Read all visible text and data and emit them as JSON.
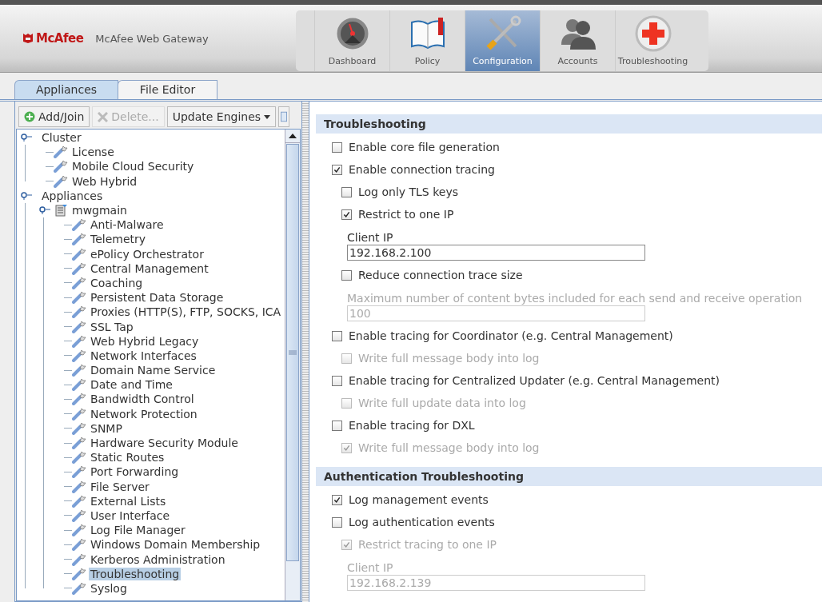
{
  "header": {
    "logo": "McAfee",
    "product": "McAfee Web Gateway"
  },
  "nav": [
    {
      "label": "Dashboard",
      "selected": false
    },
    {
      "label": "Policy",
      "selected": false
    },
    {
      "label": "Configuration",
      "selected": true
    },
    {
      "label": "Accounts",
      "selected": false
    },
    {
      "label": "Troubleshooting",
      "selected": false
    }
  ],
  "tabs": [
    {
      "label": "Appliances",
      "selected": true
    },
    {
      "label": "File Editor",
      "selected": false
    }
  ],
  "toolbar": [
    {
      "kind": "add",
      "label": "Add/Join",
      "disabled": false
    },
    {
      "kind": "delete",
      "label": "Delete...",
      "disabled": true
    },
    {
      "kind": "menu",
      "label": "Update Engines",
      "disabled": false
    }
  ],
  "tree": [
    {
      "label": "Cluster",
      "kind": "group",
      "expanded": true,
      "selected": false,
      "children": [
        {
          "label": "License",
          "kind": "setting",
          "selected": false
        },
        {
          "label": "Mobile Cloud Security",
          "kind": "setting",
          "selected": false
        },
        {
          "label": "Web Hybrid",
          "kind": "setting",
          "selected": false
        }
      ]
    },
    {
      "label": "Appliances",
      "kind": "group",
      "expanded": true,
      "selected": false,
      "children": [
        {
          "label": "mwgmain",
          "kind": "appliance",
          "expanded": true,
          "selected": false,
          "children": [
            {
              "label": "Anti-Malware",
              "kind": "setting",
              "selected": false
            },
            {
              "label": "Telemetry",
              "kind": "setting",
              "selected": false
            },
            {
              "label": "ePolicy Orchestrator",
              "kind": "setting",
              "selected": false
            },
            {
              "label": "Central Management",
              "kind": "setting",
              "selected": false
            },
            {
              "label": "Coaching",
              "kind": "setting",
              "selected": false
            },
            {
              "label": "Persistent Data Storage",
              "kind": "setting",
              "selected": false
            },
            {
              "label": "Proxies (HTTP(S), FTP, SOCKS, ICA",
              "kind": "setting",
              "selected": false
            },
            {
              "label": "SSL Tap",
              "kind": "setting",
              "selected": false
            },
            {
              "label": "Web Hybrid Legacy",
              "kind": "setting",
              "selected": false
            },
            {
              "label": "Network Interfaces",
              "kind": "setting",
              "selected": false
            },
            {
              "label": "Domain Name Service",
              "kind": "setting",
              "selected": false
            },
            {
              "label": "Date and Time",
              "kind": "setting",
              "selected": false
            },
            {
              "label": "Bandwidth Control",
              "kind": "setting",
              "selected": false
            },
            {
              "label": "Network Protection",
              "kind": "setting",
              "selected": false
            },
            {
              "label": "SNMP",
              "kind": "setting",
              "selected": false
            },
            {
              "label": "Hardware Security Module",
              "kind": "setting",
              "selected": false
            },
            {
              "label": "Static Routes",
              "kind": "setting",
              "selected": false
            },
            {
              "label": "Port Forwarding",
              "kind": "setting",
              "selected": false
            },
            {
              "label": "File Server",
              "kind": "setting",
              "selected": false
            },
            {
              "label": "External Lists",
              "kind": "setting",
              "selected": false
            },
            {
              "label": "User Interface",
              "kind": "setting",
              "selected": false
            },
            {
              "label": "Log File Manager",
              "kind": "setting",
              "selected": false
            },
            {
              "label": "Windows Domain Membership",
              "kind": "setting",
              "selected": false
            },
            {
              "label": "Kerberos Administration",
              "kind": "setting",
              "selected": false
            },
            {
              "label": "Troubleshooting",
              "kind": "setting",
              "selected": true
            },
            {
              "label": "Syslog",
              "kind": "setting",
              "selected": false
            }
          ]
        }
      ]
    }
  ],
  "sections": [
    {
      "title": "Troubleshooting",
      "items": [
        {
          "kind": "checkbox",
          "label": "Enable core file generation",
          "checked": false,
          "disabled": false
        },
        {
          "kind": "checkbox",
          "label": "Enable connection tracing",
          "checked": true,
          "disabled": false,
          "children": [
            {
              "kind": "checkbox",
              "label": "Log only TLS keys",
              "checked": false,
              "disabled": false
            },
            {
              "kind": "checkbox",
              "label": "Restrict to one IP",
              "checked": true,
              "disabled": false
            },
            {
              "kind": "field",
              "label": "Client IP",
              "value": "192.168.2.100",
              "disabled": false
            },
            {
              "kind": "checkbox",
              "label": "Reduce connection trace size",
              "checked": false,
              "disabled": false
            },
            {
              "kind": "field",
              "label": "Maximum number of content bytes included for each send and receive operation",
              "value": "100",
              "disabled": true
            }
          ]
        },
        {
          "kind": "checkbox",
          "label": "Enable tracing for Coordinator (e.g. Central Management)",
          "checked": false,
          "disabled": false,
          "children": [
            {
              "kind": "checkbox",
              "label": "Write full message body into log",
              "checked": false,
              "disabled": true
            }
          ]
        },
        {
          "kind": "checkbox",
          "label": "Enable tracing for Centralized Updater (e.g. Central Management)",
          "checked": false,
          "disabled": false,
          "children": [
            {
              "kind": "checkbox",
              "label": "Write full update data into log",
              "checked": false,
              "disabled": true
            }
          ]
        },
        {
          "kind": "checkbox",
          "label": "Enable tracing for DXL",
          "checked": false,
          "disabled": false,
          "children": [
            {
              "kind": "checkbox",
              "label": "Write full message body into log",
              "checked": true,
              "disabled": true
            }
          ]
        }
      ]
    },
    {
      "title": "Authentication Troubleshooting",
      "items": [
        {
          "kind": "checkbox",
          "label": "Log management events",
          "checked": true,
          "disabled": false
        },
        {
          "kind": "checkbox",
          "label": "Log authentication events",
          "checked": false,
          "disabled": false,
          "children": [
            {
              "kind": "checkbox",
              "label": "Restrict tracing to one IP",
              "checked": true,
              "disabled": true
            },
            {
              "kind": "field",
              "label": "Client IP",
              "value": "192.168.2.139",
              "disabled": true
            }
          ]
        }
      ]
    }
  ]
}
